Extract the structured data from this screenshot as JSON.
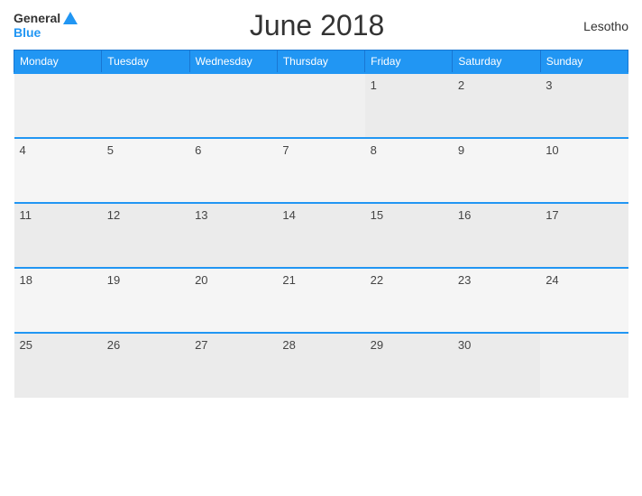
{
  "header": {
    "title": "June 2018",
    "country": "Lesotho",
    "logo_general": "General",
    "logo_blue": "Blue"
  },
  "days_of_week": [
    "Monday",
    "Tuesday",
    "Wednesday",
    "Thursday",
    "Friday",
    "Saturday",
    "Sunday"
  ],
  "weeks": [
    [
      null,
      null,
      null,
      null,
      1,
      2,
      3
    ],
    [
      4,
      5,
      6,
      7,
      8,
      9,
      10
    ],
    [
      11,
      12,
      13,
      14,
      15,
      16,
      17
    ],
    [
      18,
      19,
      20,
      21,
      22,
      23,
      24
    ],
    [
      25,
      26,
      27,
      28,
      29,
      30,
      null
    ]
  ]
}
